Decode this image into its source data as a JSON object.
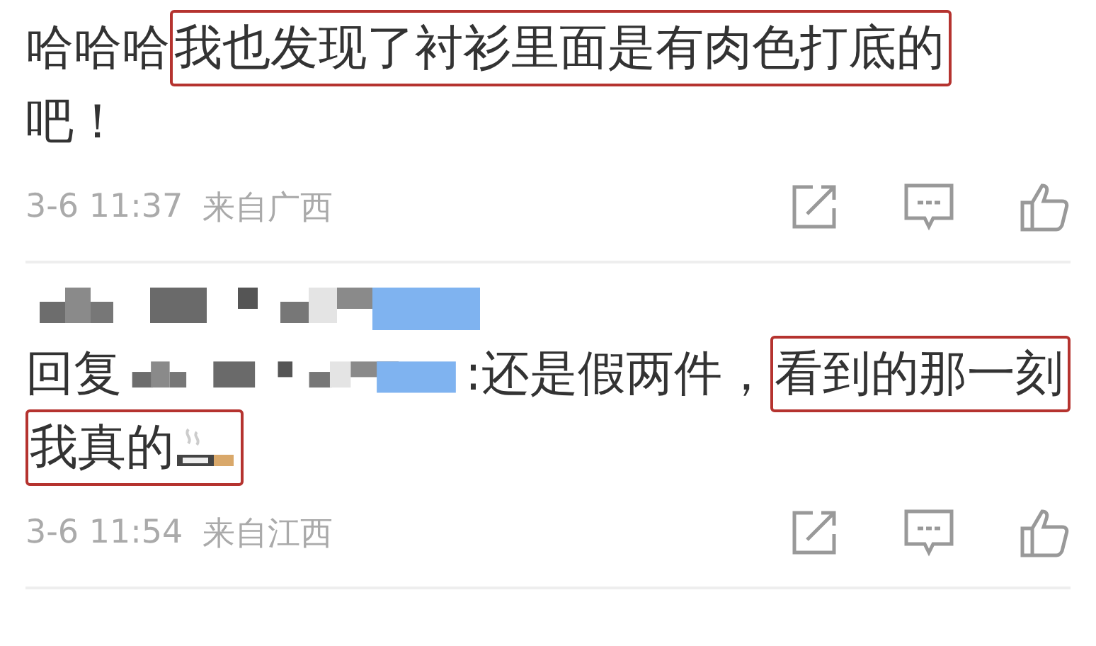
{
  "comments": [
    {
      "mosaic": false,
      "lines": [
        [
          {
            "kind": "text",
            "text": "哈哈哈",
            "highlighted": false
          },
          {
            "kind": "text",
            "text": "我也发现了衬衫里面是有肉色打底的",
            "highlighted": true
          }
        ],
        [
          {
            "kind": "text",
            "text": "吧！",
            "highlighted": false
          }
        ]
      ],
      "time": "3-6 11:37",
      "location": "来自广西"
    },
    {
      "mosaic": true,
      "lines": [
        [
          {
            "kind": "text",
            "text": "回复",
            "highlighted": false
          },
          {
            "kind": "mosaic"
          },
          {
            "kind": "text",
            "text": ":还是假两件，",
            "highlighted": false
          },
          {
            "kind": "text",
            "text": "看到的那一刻",
            "highlighted": true
          }
        ],
        [
          {
            "kind": "text_with_icon",
            "text": "我真的",
            "highlighted": true
          }
        ]
      ],
      "time": "3-6 11:54",
      "location": "来自江西"
    }
  ]
}
